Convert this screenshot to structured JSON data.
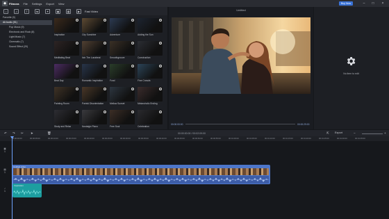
{
  "app": {
    "name": "Filmora",
    "menu": [
      "File",
      "Settings",
      "Export",
      "View"
    ],
    "buy_now": "Buy Now"
  },
  "toolbar": {
    "section_label": "Fast Video"
  },
  "sidebar": {
    "items": [
      {
        "label": "Favorite (0)",
        "selected": false,
        "sub": false
      },
      {
        "label": "All Audio (51)",
        "selected": true,
        "sub": false
      },
      {
        "label": "Pop Music (9)",
        "selected": false,
        "sub": true
      },
      {
        "label": "Electronic and Rock (8)",
        "selected": false,
        "sub": true
      },
      {
        "label": "Light Music (7)",
        "selected": false,
        "sub": true
      },
      {
        "label": "Cinematic (7)",
        "selected": false,
        "sub": true
      },
      {
        "label": "Sound Effect (20)",
        "selected": false,
        "sub": true
      }
    ]
  },
  "library": {
    "items": [
      {
        "label": "Inspiration",
        "color": "#3b2a1c"
      },
      {
        "label": "City Sunshine",
        "color": "#5d4a33"
      },
      {
        "label": "Adventure",
        "color": "#2c3a52"
      },
      {
        "label": "Adding the Sun",
        "color": "#1d2430"
      },
      {
        "label": "Meditating Beat",
        "color": "#2d2424"
      },
      {
        "label": "Itch The Lunabeat",
        "color": "#514032"
      },
      {
        "label": "Smoothgroove",
        "color": "#3a3026"
      },
      {
        "label": "Construction",
        "color": "#2b2d33"
      },
      {
        "label": "Beat Day",
        "color": "#4c2c63"
      },
      {
        "label": "Romantic Inspiration",
        "color": "#28354a"
      },
      {
        "label": "Fund",
        "color": "#2a3d2a"
      },
      {
        "label": "Fine Crowds",
        "color": "#2c4458"
      },
      {
        "label": "Painting Room",
        "color": "#403326"
      },
      {
        "label": "Painful Disorientation",
        "color": "#4a3828"
      },
      {
        "label": "Mellow Sunset",
        "color": "#2d3640"
      },
      {
        "label": "Melancholic Ending",
        "color": "#3a2c2c"
      },
      {
        "label": "Study and Relax",
        "color": "#2d2d33"
      },
      {
        "label": "Nostalgic Piano",
        "color": "#3a3a3e"
      },
      {
        "label": "Free Soul",
        "color": "#3c2e26"
      },
      {
        "label": "Celebration",
        "color": "#2a2a2e"
      }
    ]
  },
  "player": {
    "title": "Untitled",
    "time_current": "00:00:00:00",
    "time_total": "00:00:29:00"
  },
  "properties": {
    "empty_text": "No item to edit"
  },
  "timeline": {
    "time_display": "00:00:00:00 / 00:02:09:00",
    "export_label": "Export",
    "ruler": [
      "00:00:00:00",
      "00:00:05:00",
      "00:00:10:00",
      "00:00:15:00",
      "00:00:20:00",
      "00:00:25:00",
      "00:00:30:00",
      "00:00:35:00",
      "00:00:40:00",
      "00:00:45:00",
      "00:00:50:00",
      "00:00:55:00",
      "00:01:00:00",
      "00:01:05:00",
      "00:01:10:00",
      "00:01:15:00",
      "00:01:20:00",
      "00:01:25:00",
      "00:01:30:00",
      "00:01:35:00"
    ],
    "video_clip_label": "Untitled video",
    "audio_clip_label": "Inspiration",
    "track_labels": [
      "1",
      "1",
      "1"
    ]
  },
  "colors": {
    "accent": "#3a73d8",
    "video_clip": "#4d76c9",
    "audio_clip": "#1d9ea0",
    "playhead": "#6ea2ff"
  }
}
